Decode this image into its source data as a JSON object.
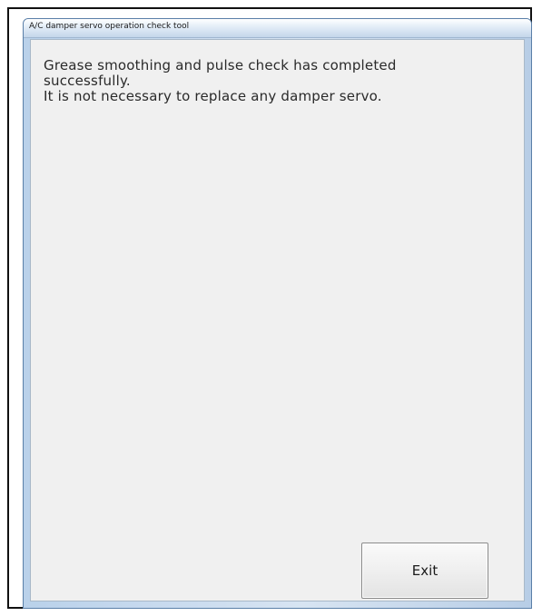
{
  "window": {
    "title": "A/C damper servo operation check tool"
  },
  "message": {
    "lines": [
      "Grease smoothing and pulse check has completed",
      "successfully.",
      "It is not necessary to replace any damper servo."
    ]
  },
  "buttons": {
    "exit_label": "Exit"
  },
  "colors": {
    "window_frame": "#b9d1ea",
    "client_background": "#f0f0f0",
    "text": "#2a2a2a"
  }
}
